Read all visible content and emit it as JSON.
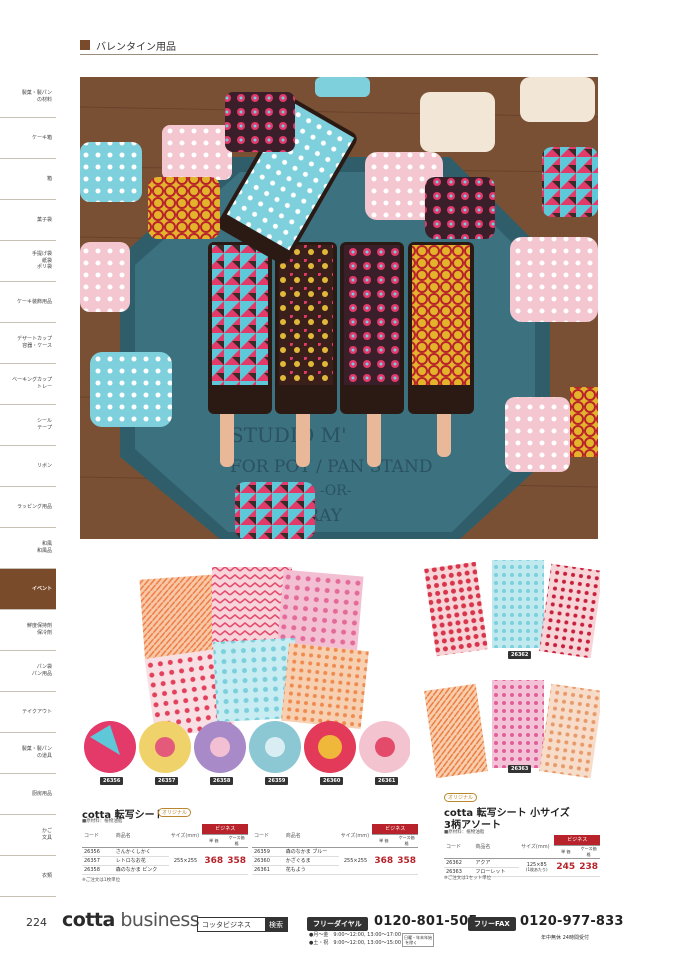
{
  "header": {
    "title": "バレンタイン用品"
  },
  "sidebar": {
    "items": [
      {
        "label": "製菓・製パン\nの材料"
      },
      {
        "label": "ケーキ箱"
      },
      {
        "label": "箱"
      },
      {
        "label": "菓子袋"
      },
      {
        "label": "手提げ袋\n紙袋\nポリ袋"
      },
      {
        "label": "ケーキ装飾用品"
      },
      {
        "label": "デザートカップ\n容器・ケース"
      },
      {
        "label": "ベーキングカップ\nトレー"
      },
      {
        "label": "シール\nテープ"
      },
      {
        "label": "リボン"
      },
      {
        "label": "ラッピング用品"
      },
      {
        "label": "和風\n和風品"
      },
      {
        "label": "イベント",
        "active": true
      },
      {
        "label": "鮮度保持剤\n保冷剤"
      },
      {
        "label": "パン袋\nパン用品"
      },
      {
        "label": "テイクアウト"
      },
      {
        "label": "製菓・製パン\nの道具"
      },
      {
        "label": "厨房用品"
      },
      {
        "label": "かご\n文具"
      },
      {
        "label": "衣類"
      }
    ]
  },
  "product_tags": {
    "t26356": "26356",
    "t26357": "26357",
    "t26358": "26358",
    "t26359": "26359",
    "t26360": "26360",
    "t26361": "26361",
    "t26362": "26362",
    "t26363": "26363"
  },
  "product1": {
    "name": "cotta 転写シート",
    "original": "オリジナル",
    "material": "■原材料：植物油脂",
    "headers": {
      "code": "コード",
      "name": "商品名",
      "size": "サイズ(mm)",
      "biz": "ビジネス",
      "unit": "単 価",
      "sub": "ケース価格"
    },
    "left_rows": [
      {
        "code": "26356",
        "name": "さんかくしかく"
      },
      {
        "code": "26357",
        "name": "レトロなお花"
      },
      {
        "code": "26358",
        "name": "森のなかま ピンク"
      }
    ],
    "left_size": "255×255",
    "left_price1": "368",
    "left_price2": "358",
    "right_rows": [
      {
        "code": "26359",
        "name": "森のなかま ブルー"
      },
      {
        "code": "26360",
        "name": "かざぐるま"
      },
      {
        "code": "26361",
        "name": "花もよう"
      }
    ],
    "right_size": "255×255",
    "right_price1": "368",
    "right_price2": "358",
    "footnote": "※ご注文は1枚単位"
  },
  "product2": {
    "original": "オリジナル",
    "name_line1": "cotta 転写シート 小サイズ",
    "name_line2": "3柄アソート",
    "material": "■原材料：植物油脂",
    "rows": [
      {
        "code": "26362",
        "name": "アクア"
      },
      {
        "code": "26363",
        "name": "フローレット"
      }
    ],
    "size": "125×85",
    "size_note": "(1枚あたり)",
    "price1": "245",
    "price2": "238",
    "footnote": "※ご注文は1セット単位"
  },
  "footer": {
    "page": "224",
    "logo_main": "cotta",
    "logo_sub": "business",
    "search_text": "コッタビジネス",
    "search_btn": "検索",
    "free_dial_label": "フリーダイヤル",
    "free_dial": "0120-801-505",
    "fax_label": "フリーFAX",
    "fax": "0120-977-833",
    "hours1": "●月〜金　9:00〜12:00, 13:00〜17:00",
    "hours2": "●土・祝　9:00〜12:00, 13:00〜15:00",
    "closed": "日曜・年末年始\n を除く",
    "fax_note": "年中無休 24時間受付"
  },
  "colors": {
    "accent": "#7a4b2a",
    "price": "#b8232b"
  }
}
